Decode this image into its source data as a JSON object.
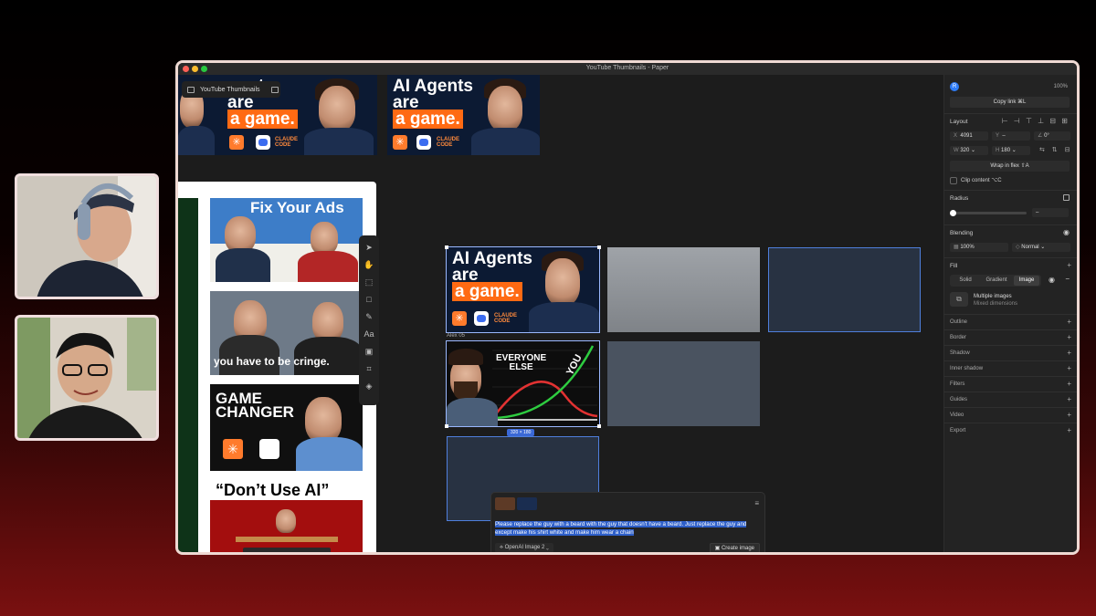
{
  "window": {
    "title": "YouTube Thumbnails - Paper"
  },
  "canvas": {
    "file_tab": "YouTube Thumbnails",
    "top_thumbs": [
      {
        "title_lines": [
          "gents",
          "are",
          "a game."
        ],
        "claude": "CLAUDE\nCODE"
      },
      {
        "title_lines": [
          "AI Agents",
          "are",
          "a game."
        ],
        "claude": "CLAUDE\nCODE"
      }
    ],
    "left_thumbs": [
      {
        "title": "Fix Your Ads"
      },
      {
        "title": "you have to be cringe."
      },
      {
        "title": "GAME CHANGER"
      },
      {
        "title": "“Don’t Use AI”"
      }
    ],
    "selected": {
      "thumb1": {
        "title_lines": [
          "AI Agents",
          "are",
          "a game."
        ],
        "claude": "CLAUDE\nCODE"
      },
      "caption": "Alex 05",
      "thumb2": {
        "label1": "EVERYONE",
        "label2": "ELSE",
        "label3": "YOU"
      },
      "dimension": "320 × 180"
    },
    "prompt": {
      "text": "Please replace the guy with a beard with the guy that doesn't have a beard. Just replace the guy and except make his shirt white and make him wear a chain",
      "model": "OpenAI Image 2",
      "create_label": "Create image"
    }
  },
  "panel": {
    "avatar": "R",
    "zoom": "100%",
    "copy_link": "Copy link ⌘L",
    "layout_label": "Layout",
    "x_label": "X",
    "x_value": "4091",
    "y_label": "Y",
    "y_value": "–",
    "rot_value": "0°",
    "w_label": "W",
    "w_value": "320",
    "h_label": "H",
    "h_value": "180",
    "wrap": "Wrap in flex ⇧A",
    "clip": "Clip content ⌥C",
    "radius_label": "Radius",
    "radius_value": "–",
    "blending_label": "Blending",
    "opacity": "100%",
    "blend_mode": "Normal",
    "fill_label": "Fill",
    "fill_tabs": [
      "Solid",
      "Gradient",
      "Image"
    ],
    "fill_note1": "Multiple images",
    "fill_note2": "Mixed dimensions",
    "sections": [
      "Outline",
      "Border",
      "Shadow",
      "Inner shadow",
      "Filters",
      "Guides",
      "Video",
      "Export"
    ]
  },
  "colors": {
    "accent": "#3a68d6",
    "orange": "#ff6a13",
    "panel": "#232323"
  }
}
